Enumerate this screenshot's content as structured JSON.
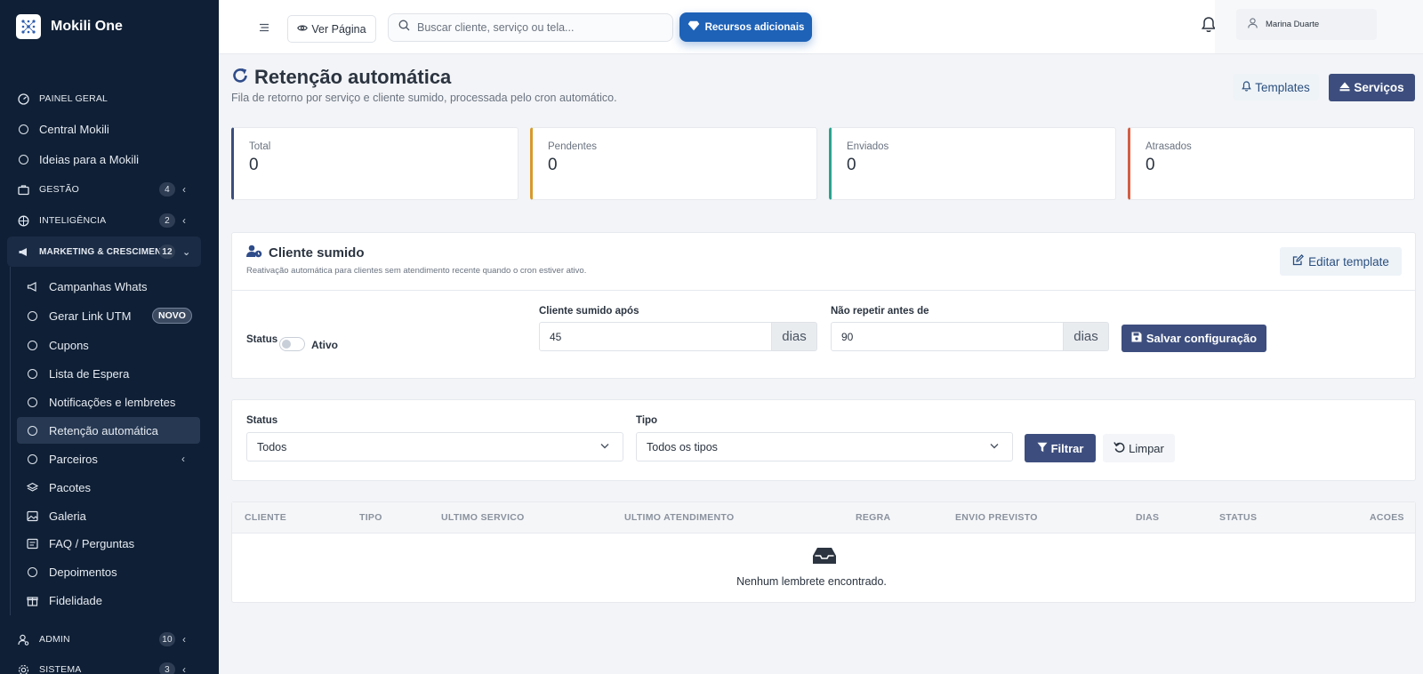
{
  "app": {
    "name": "Mokili One"
  },
  "sidebar": {
    "sections": [
      {
        "label": "PAINEL GERAL",
        "count": "",
        "icon": "dashboard-icon"
      },
      {
        "label": "Central Mokili",
        "count": "",
        "icon": "circle-icon"
      },
      {
        "label": "Ideias para a Mokili",
        "count": "",
        "icon": "circle-icon"
      },
      {
        "label": "GESTÃO",
        "count": "4",
        "icon": "briefcase-icon"
      },
      {
        "label": "INTELIGÊNCIA",
        "count": "2",
        "icon": "brain-icon"
      },
      {
        "label": "MARKETING & CRESCIMENTO",
        "count": "12",
        "icon": "megaphone-icon"
      },
      {
        "label": "ADMIN",
        "count": "10",
        "icon": "user-cog-icon"
      },
      {
        "label": "SISTEMA",
        "count": "3",
        "icon": "gear-icon"
      }
    ],
    "marketing_items": [
      {
        "label": "Campanhas Whats",
        "icon": "megaphone-icon"
      },
      {
        "label": "Gerar Link UTM",
        "icon": "circle-icon",
        "badge": "NOVO"
      },
      {
        "label": "Cupons",
        "icon": "circle-icon"
      },
      {
        "label": "Lista de Espera",
        "icon": "circle-icon"
      },
      {
        "label": "Notificações e lembretes",
        "icon": "circle-icon"
      },
      {
        "label": "Retenção automática",
        "icon": "circle-icon",
        "active": true
      },
      {
        "label": "Parceiros",
        "icon": "circle-icon"
      },
      {
        "label": "Pacotes",
        "icon": "layers-icon"
      },
      {
        "label": "Galeria",
        "icon": "image-icon"
      },
      {
        "label": "FAQ / Perguntas",
        "icon": "faq-icon"
      },
      {
        "label": "Depoimentos",
        "icon": "circle-icon"
      },
      {
        "label": "Fidelidade",
        "icon": "gift-icon"
      }
    ]
  },
  "topbar": {
    "ver_pagina": "Ver Página",
    "search_placeholder": "Buscar cliente, serviço ou tela...",
    "recursos": "Recursos adicionais",
    "user_name": "Marina Duarte"
  },
  "page": {
    "title": "Retenção automática",
    "subtitle": "Fila de retorno por serviço e cliente sumido, processada pelo cron automático.",
    "templates_btn": "Templates",
    "servicos_btn": "Serviços"
  },
  "stats": [
    {
      "label": "Total",
      "value": "0",
      "color": "#3d4e7e"
    },
    {
      "label": "Pendentes",
      "value": "0",
      "color": "#d89a2c"
    },
    {
      "label": "Enviados",
      "value": "0",
      "color": "#2aa38f"
    },
    {
      "label": "Atrasados",
      "value": "0",
      "color": "#d35f44"
    }
  ],
  "cliente_sumido": {
    "title": "Cliente sumido",
    "description": "Reativação automática para clientes sem atendimento recente quando o cron estiver ativo.",
    "edit_btn": "Editar template",
    "status_label": "Status",
    "status_value": "Ativo",
    "after_label": "Cliente sumido após",
    "after_value": "45",
    "after_unit": "dias",
    "repeat_label": "Não repetir antes de",
    "repeat_value": "90",
    "repeat_unit": "dias",
    "save_btn": "Salvar configuração"
  },
  "filters": {
    "status_label": "Status",
    "status_value": "Todos",
    "tipo_label": "Tipo",
    "tipo_value": "Todos os tipos",
    "filtrar_btn": "Filtrar",
    "limpar_btn": "Limpar"
  },
  "table": {
    "columns": [
      "CLIENTE",
      "TIPO",
      "ULTIMO SERVICO",
      "ULTIMO ATENDIMENTO",
      "REGRA",
      "ENVIO PREVISTO",
      "DIAS",
      "STATUS",
      "ACOES"
    ],
    "empty_message": "Nenhum lembrete encontrado."
  },
  "colors": {
    "sidebar_bg": "#0f1f35",
    "primary": "#3d4e7e",
    "accent_blue": "#1e62b7"
  }
}
